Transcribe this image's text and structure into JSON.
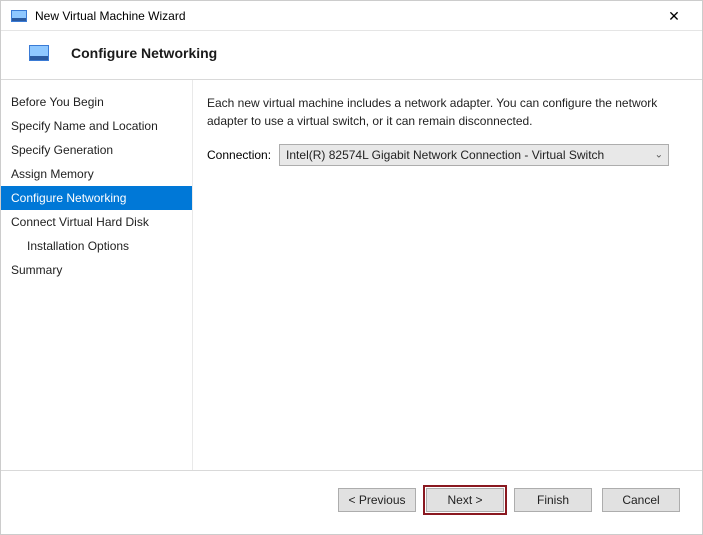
{
  "titlebar": {
    "title": "New Virtual Machine Wizard"
  },
  "header": {
    "heading": "Configure Networking"
  },
  "sidebar": {
    "items": [
      {
        "label": "Before You Begin"
      },
      {
        "label": "Specify Name and Location"
      },
      {
        "label": "Specify Generation"
      },
      {
        "label": "Assign Memory"
      },
      {
        "label": "Configure Networking"
      },
      {
        "label": "Connect Virtual Hard Disk"
      },
      {
        "label": "Installation Options"
      },
      {
        "label": "Summary"
      }
    ]
  },
  "main": {
    "description": "Each new virtual machine includes a network adapter. You can configure the network adapter to use a virtual switch, or it can remain disconnected.",
    "connection_label": "Connection:",
    "connection_value": "Intel(R) 82574L Gigabit Network Connection - Virtual Switch"
  },
  "buttons": {
    "previous": "< Previous",
    "next": "Next >",
    "finish": "Finish",
    "cancel": "Cancel"
  }
}
